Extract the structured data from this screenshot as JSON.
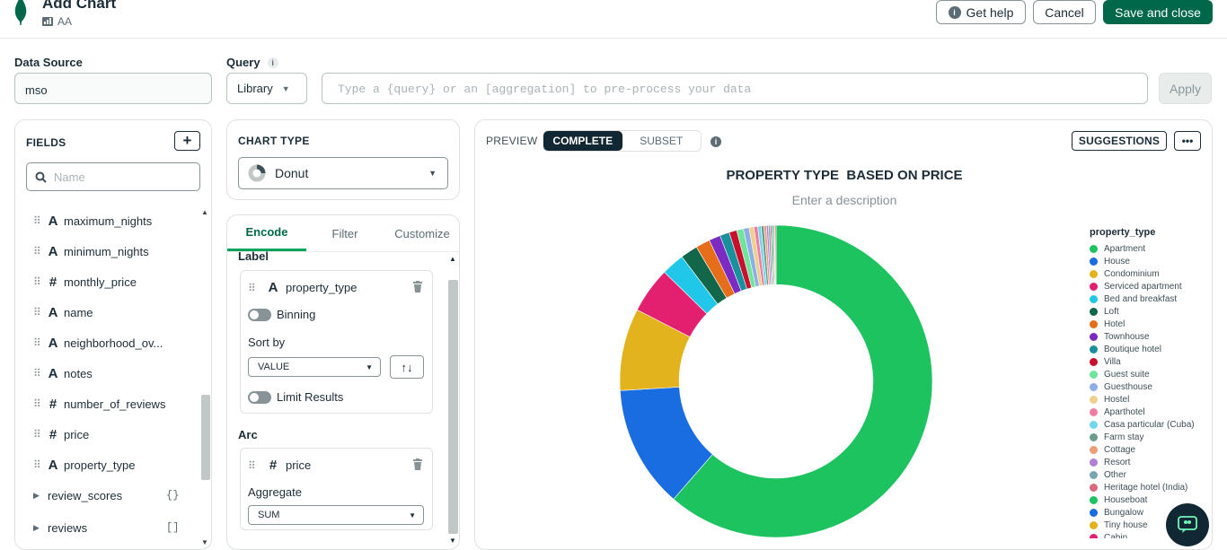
{
  "header": {
    "title": "Add Chart",
    "subtitle": "AA",
    "get_help": "Get help",
    "cancel": "Cancel",
    "save": "Save and close"
  },
  "data_source": {
    "label": "Data Source",
    "value": "mso"
  },
  "query": {
    "label": "Query",
    "library": "Library",
    "placeholder": "Type a {query} or an [aggregation] to pre-process your data",
    "apply": "Apply"
  },
  "fields_panel": {
    "title": "FIELDS",
    "search_placeholder": "Name",
    "items": [
      {
        "type": "A",
        "name": "maximum_nights"
      },
      {
        "type": "A",
        "name": "minimum_nights"
      },
      {
        "type": "#",
        "name": "monthly_price"
      },
      {
        "type": "A",
        "name": "name"
      },
      {
        "type": "A",
        "name": "neighborhood_ov..."
      },
      {
        "type": "A",
        "name": "notes"
      },
      {
        "type": "#",
        "name": "number_of_reviews"
      },
      {
        "type": "#",
        "name": "price"
      },
      {
        "type": "A",
        "name": "property_type"
      }
    ],
    "groups": [
      {
        "name": "review_scores",
        "badge": "{}"
      },
      {
        "name": "reviews",
        "badge": "[]"
      }
    ]
  },
  "chart_type": {
    "title": "CHART TYPE",
    "value": "Donut"
  },
  "encode": {
    "tabs": [
      "Encode",
      "Filter",
      "Customize"
    ],
    "label_section": "Label",
    "label_field": "property_type",
    "binning": "Binning",
    "sort_by": "Sort by",
    "sort_value": "VALUE",
    "limit_results": "Limit Results",
    "arc_section": "Arc",
    "arc_field": "price",
    "aggregate": "Aggregate",
    "aggregate_value": "SUM"
  },
  "preview": {
    "label": "PREVIEW",
    "complete": "COMPLETE",
    "subset": "SUBSET",
    "suggestions": "SUGGESTIONS",
    "more": "•••"
  },
  "chart_data": {
    "type": "pie",
    "title": "PROPERTY TYPE  BASED ON PRICE",
    "subtitle": "Enter a description",
    "legend_title": "property_type",
    "legend_position": "right",
    "inner_radius_ratio": 0.62,
    "categories": [
      "Apartment",
      "House",
      "Condominium",
      "Serviced apartment",
      "Bed and breakfast",
      "Loft",
      "Hotel",
      "Townhouse",
      "Boutique hotel",
      "Villa",
      "Guest suite",
      "Guesthouse",
      "Hostel",
      "Aparthotel",
      "Casa particular (Cuba)",
      "Farm stay",
      "Cottage",
      "Resort",
      "Other",
      "Heritage hotel (India)",
      "Houseboat",
      "Bungalow",
      "Tiny house",
      "Cabin"
    ],
    "values": [
      62.0,
      12.8,
      8.6,
      4.8,
      2.4,
      1.8,
      1.5,
      1.2,
      1.0,
      0.8,
      0.7,
      0.6,
      0.5,
      0.4,
      0.35,
      0.3,
      0.25,
      0.2,
      0.2,
      0.15,
      0.15,
      0.1,
      0.1,
      0.1
    ],
    "colors": [
      "#1cc35f",
      "#1a6de0",
      "#e2b31d",
      "#e3206f",
      "#20c7e8",
      "#12664a",
      "#e66d1a",
      "#7c2bc2",
      "#19919d",
      "#c8102e",
      "#6fe49a",
      "#8eaee8",
      "#f0ce8c",
      "#f07ea2",
      "#73d8ef",
      "#6b9e8a",
      "#ed9e76",
      "#b47fd6",
      "#77a7b0",
      "#d96a7e",
      "#1cc35f",
      "#1a6de0",
      "#e2b31d",
      "#e3206f"
    ]
  }
}
